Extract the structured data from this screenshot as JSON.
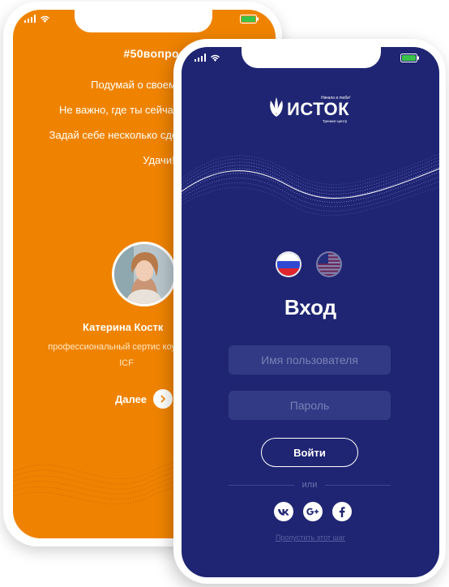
{
  "back_phone": {
    "hashtag": "#50вопросов_и",
    "paragraph_1": "Подумай о своем жел цели.",
    "paragraph_2": "Не важно, где ты сейча или на полпути к",
    "paragraph_3": "Задай себе несколько сделай шаг навстречу",
    "paragraph_4": "Удачи!",
    "author_name": "Катерина Костк",
    "author_desc": "профессиональный сертис коуч (PCC ICF",
    "next_label": "Далее"
  },
  "front_phone": {
    "logo": {
      "word": "ИСТОК",
      "tagline": "Начало в тебе!",
      "subtitle": "Тренинг-центр"
    },
    "languages": [
      "ru-flag-icon",
      "us-flag-icon"
    ],
    "title": "Вход",
    "username_placeholder": "Имя пользователя",
    "password_placeholder": "Пароль",
    "login_label": "Войти",
    "or_label": "или",
    "social_buttons": [
      "vk-icon",
      "google-plus-icon",
      "facebook-icon"
    ],
    "skip_label": "Пропустить этот шаг"
  },
  "colors": {
    "orange": "#ef8300",
    "navy": "#1f2572",
    "field": "#323a86",
    "battery": "#3ac34a"
  }
}
